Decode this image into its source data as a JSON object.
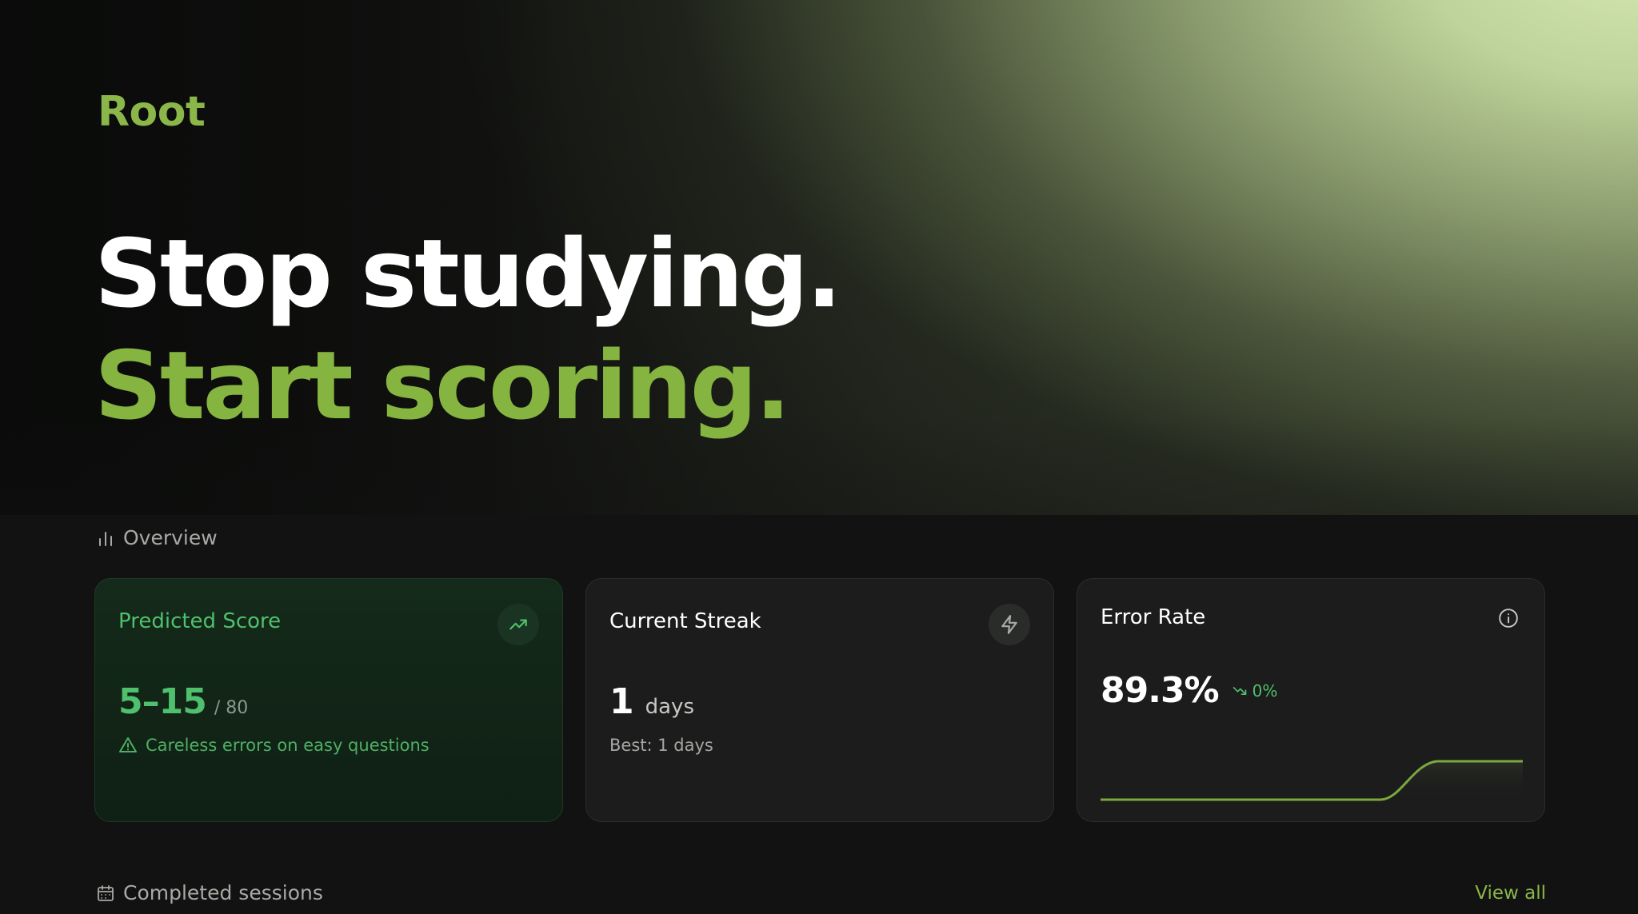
{
  "brand": {
    "name": "Root"
  },
  "hero": {
    "line1": "Stop studying.",
    "line2": "Start scoring."
  },
  "overview": {
    "label": "Overview",
    "icon": "bar-chart-icon"
  },
  "cards": {
    "predicted_score": {
      "title": "Predicted Score",
      "icon": "trending-up-icon",
      "value": "5–15",
      "total": "/ 80",
      "warning_icon": "warning-triangle-icon",
      "warning": "Careless errors on easy questions"
    },
    "current_streak": {
      "title": "Current Streak",
      "icon": "lightning-icon",
      "value": "1",
      "unit": "days",
      "best": "Best: 1 days"
    },
    "error_rate": {
      "title": "Error Rate",
      "icon": "info-icon",
      "value": "89.3%",
      "change_icon": "trending-down-icon",
      "change": "0%"
    }
  },
  "sessions": {
    "label": "Completed sessions",
    "icon": "calendar-icon",
    "view_all": "View all"
  },
  "colors": {
    "accent": "#8bb64a",
    "success": "#4fc06d",
    "background": "#111211",
    "card": "#1b1c1b"
  }
}
